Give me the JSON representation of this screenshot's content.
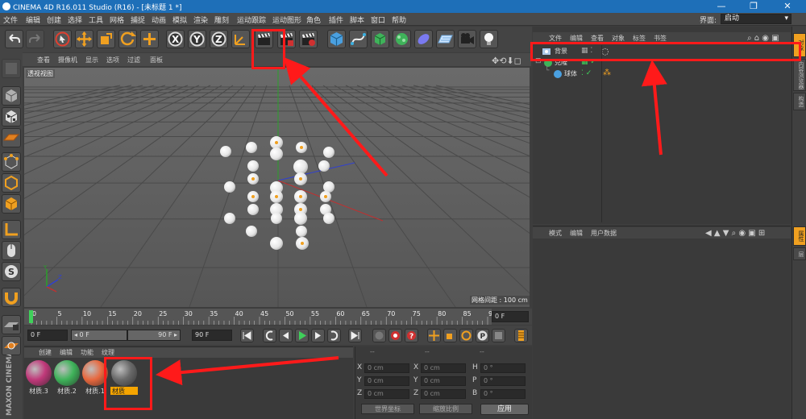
{
  "window": {
    "title": "CINEMA 4D R16.011 Studio (R16) - [未标题 1 *]",
    "controls": [
      "—",
      "❐",
      "✕"
    ]
  },
  "menubar": {
    "items": [
      "文件",
      "编辑",
      "创建",
      "选择",
      "工具",
      "网格",
      "捕捉",
      "动画",
      "模拟",
      "渲染",
      "雕刻",
      "运动跟踪",
      "运动图形",
      "角色",
      "插件",
      "脚本",
      "窗口",
      "帮助"
    ],
    "layout_label": "界面:",
    "layout_value": "启动"
  },
  "viewport": {
    "menu": [
      "查看",
      "摄像机",
      "显示",
      "选项",
      "过滤",
      "面板"
    ],
    "label": "透视视图",
    "grid_spacing": "网格间距 : 100 cm"
  },
  "timeline": {
    "ticks": [
      "0",
      "5",
      "10",
      "15",
      "20",
      "25",
      "30",
      "35",
      "40",
      "45",
      "50",
      "55",
      "60",
      "65",
      "70",
      "75",
      "80",
      "85",
      "90"
    ],
    "frame_field": "0 F"
  },
  "playback": {
    "start_field": "0 F",
    "range_start": "◂ 0 F",
    "range_end": "90 F ▸",
    "end_field": "90 F"
  },
  "materials": {
    "menu": [
      "创建",
      "编辑",
      "功能",
      "纹理"
    ],
    "items": [
      {
        "label": "材质.3",
        "color": "#c0397a"
      },
      {
        "label": "材质.2",
        "color": "#3fb35a"
      },
      {
        "label": "材质.1",
        "color": "#e8683e"
      },
      {
        "label": "材质",
        "color": "#6a6a6a"
      }
    ]
  },
  "coordinates": {
    "headers": [
      "--",
      "--",
      "--"
    ],
    "rows": [
      {
        "a": "X",
        "av": "0 cm",
        "b": "X",
        "bv": "0 cm",
        "c": "H",
        "cv": "0 °"
      },
      {
        "a": "Y",
        "av": "0 cm",
        "b": "Y",
        "bv": "0 cm",
        "c": "P",
        "cv": "0 °"
      },
      {
        "a": "Z",
        "av": "0 cm",
        "b": "Z",
        "bv": "0 cm",
        "c": "B",
        "cv": "0 °"
      }
    ],
    "mode1": "世界坐标",
    "mode2": "缩放比例",
    "apply": "应用"
  },
  "objects": {
    "menu": [
      "文件",
      "编辑",
      "查看",
      "对象",
      "标签",
      "书签"
    ],
    "rows": [
      {
        "name": "背景"
      },
      {
        "name": "克隆"
      },
      {
        "name": "球体"
      }
    ]
  },
  "attributes": {
    "menu": [
      "模式",
      "编辑",
      "用户数据"
    ]
  },
  "rightstrip": {
    "tabs": [
      "对象",
      "内容浏览器",
      "构造",
      "属性",
      "层"
    ]
  },
  "brand": {
    "logo": "MAXON CINEMA 4D"
  },
  "colors": {
    "highlight": "#ff1a1a",
    "accent": "#f0a020",
    "selection": "#f5a500"
  }
}
